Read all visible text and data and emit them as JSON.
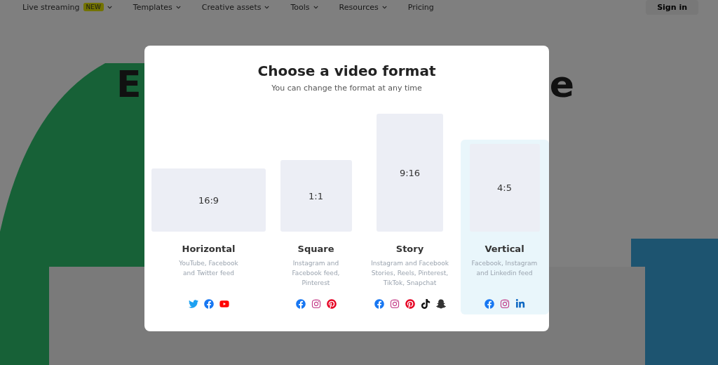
{
  "nav": {
    "items": [
      {
        "label": "Live streaming",
        "badge": "NEW",
        "dropdown": true
      },
      {
        "label": "Templates",
        "dropdown": true
      },
      {
        "label": "Creative assets",
        "dropdown": true
      },
      {
        "label": "Tools",
        "dropdown": true
      },
      {
        "label": "Resources",
        "dropdown": true
      },
      {
        "label": "Pricing",
        "dropdown": false
      }
    ],
    "sign_in": "Sign in"
  },
  "headline": {
    "left": "E",
    "right": "e"
  },
  "modal": {
    "title": "Choose a video format",
    "subtitle": "You can change the format at any time",
    "formats": [
      {
        "ratio": "16:9",
        "name": "Horizontal",
        "description": "YouTube, Facebook and Twitter feed",
        "selected": false,
        "platforms": [
          {
            "kind": "twitter"
          },
          {
            "kind": "facebook"
          },
          {
            "kind": "youtube"
          }
        ]
      },
      {
        "ratio": "1:1",
        "name": "Square",
        "description": "Instagram and Facebook feed, Pinterest",
        "selected": false,
        "platforms": [
          {
            "kind": "facebook"
          },
          {
            "kind": "instagram"
          },
          {
            "kind": "pinterest"
          }
        ]
      },
      {
        "ratio": "9:16",
        "name": "Story",
        "description": "Instagram and Facebook Stories, Reels, Pinterest, TikTok, Snapchat",
        "selected": false,
        "platforms": [
          {
            "kind": "facebook"
          },
          {
            "kind": "instagram"
          },
          {
            "kind": "pinterest"
          },
          {
            "kind": "tiktok"
          },
          {
            "kind": "snapchat"
          }
        ]
      },
      {
        "ratio": "4:5",
        "name": "Vertical",
        "description": "Facebook, Instagram and Linkedin feed",
        "selected": true,
        "platforms": [
          {
            "kind": "facebook"
          },
          {
            "kind": "instagram"
          },
          {
            "kind": "linkedin"
          }
        ]
      }
    ]
  }
}
